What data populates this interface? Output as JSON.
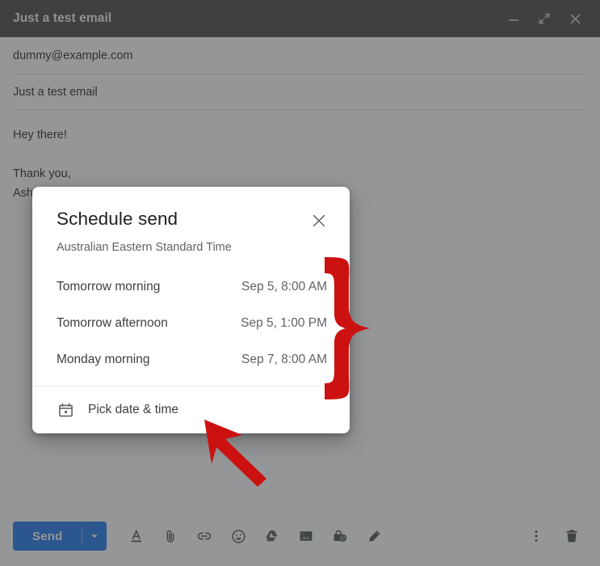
{
  "window": {
    "title": "Just a test email",
    "controls": [
      {
        "name": "minimize",
        "glyph": "minimize-icon"
      },
      {
        "name": "expand",
        "glyph": "expand-icon"
      },
      {
        "name": "close",
        "glyph": "close-icon"
      }
    ]
  },
  "compose": {
    "recipient": "dummy@example.com",
    "subject": "Just a test email",
    "body_greeting": "Hey there!",
    "body_closing": "Thank you,",
    "body_signature": "Ash"
  },
  "toolbar": {
    "send_label": "Send",
    "send_caret": "caret-down-icon",
    "icons": [
      {
        "name": "formatting-options-icon",
        "label": "Formatting options"
      },
      {
        "name": "attach-file-icon",
        "label": "Attach files"
      },
      {
        "name": "insert-link-icon",
        "label": "Insert link"
      },
      {
        "name": "insert-emoji-icon",
        "label": "Insert emoji"
      },
      {
        "name": "insert-drive-icon",
        "label": "Insert files using Drive"
      },
      {
        "name": "insert-photo-icon",
        "label": "Insert photo"
      },
      {
        "name": "confidential-mode-icon",
        "label": "Toggle confidential mode"
      },
      {
        "name": "insert-signature-icon",
        "label": "Insert signature"
      }
    ],
    "right_icons": [
      {
        "name": "more-options-icon",
        "label": "More options"
      },
      {
        "name": "discard-draft-icon",
        "label": "Discard draft"
      }
    ]
  },
  "dialog": {
    "title": "Schedule send",
    "subtitle": "Australian Eastern Standard Time",
    "close_icon": "close-icon",
    "options": [
      {
        "label": "Tomorrow morning",
        "time": "Sep 5, 8:00 AM"
      },
      {
        "label": "Tomorrow afternoon",
        "time": "Sep 5, 1:00 PM"
      },
      {
        "label": "Monday morning",
        "time": "Sep 7, 8:00 AM"
      }
    ],
    "pick_label": "Pick date & time",
    "pick_icon": "calendar-icon"
  },
  "annotations": {
    "brace": "red-curly-brace",
    "arrow": "red-arrow-pointer",
    "color": "#cc1111"
  },
  "colors": {
    "header_bg": "#404040",
    "send_blue": "#1a73e8",
    "annotation_red": "#cc1111",
    "scrim": "rgba(60,64,67,0.55)"
  }
}
